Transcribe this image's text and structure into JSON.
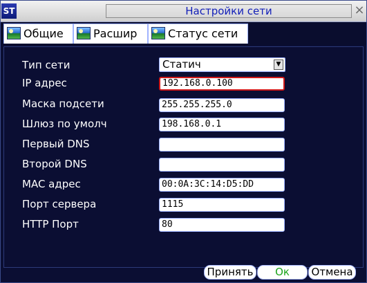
{
  "window": {
    "logo": "ST",
    "title": "Настройки сети",
    "close_glyph": "×"
  },
  "tabs": [
    {
      "label": "Общие",
      "icon": "network-picture-icon",
      "active": true
    },
    {
      "label": "Расшир",
      "icon": "network-picture-icon",
      "active": false
    },
    {
      "label": "Статус сети",
      "icon": "network-picture-icon",
      "active": false
    }
  ],
  "form": {
    "network_type": {
      "label": "Тип сети",
      "value": "Статич",
      "arrow": "▼"
    },
    "ip": {
      "label": "IP адрес",
      "value": "192.168.0.100"
    },
    "mask": {
      "label": "Маска подсети",
      "value": "255.255.255.0"
    },
    "gateway": {
      "label": "Шлюз по умолч",
      "value": "198.168.0.1"
    },
    "dns1": {
      "label": "Первый DNS",
      "value": ""
    },
    "dns2": {
      "label": "Второй DNS",
      "value": ""
    },
    "mac": {
      "label": "MAC адрес",
      "value": "00:0A:3C:14:D5:DD"
    },
    "server_port": {
      "label": "Порт сервера",
      "value": "1115"
    },
    "http_port": {
      "label": "HTTP Порт",
      "value": "80"
    }
  },
  "buttons": {
    "apply": "Принять",
    "ok": "Ок",
    "cancel": "Отмена"
  },
  "colors": {
    "background": "#0b0e33",
    "title_text": "#111eb8",
    "ok_text": "#1ba31b",
    "focus_border": "#d01818"
  }
}
